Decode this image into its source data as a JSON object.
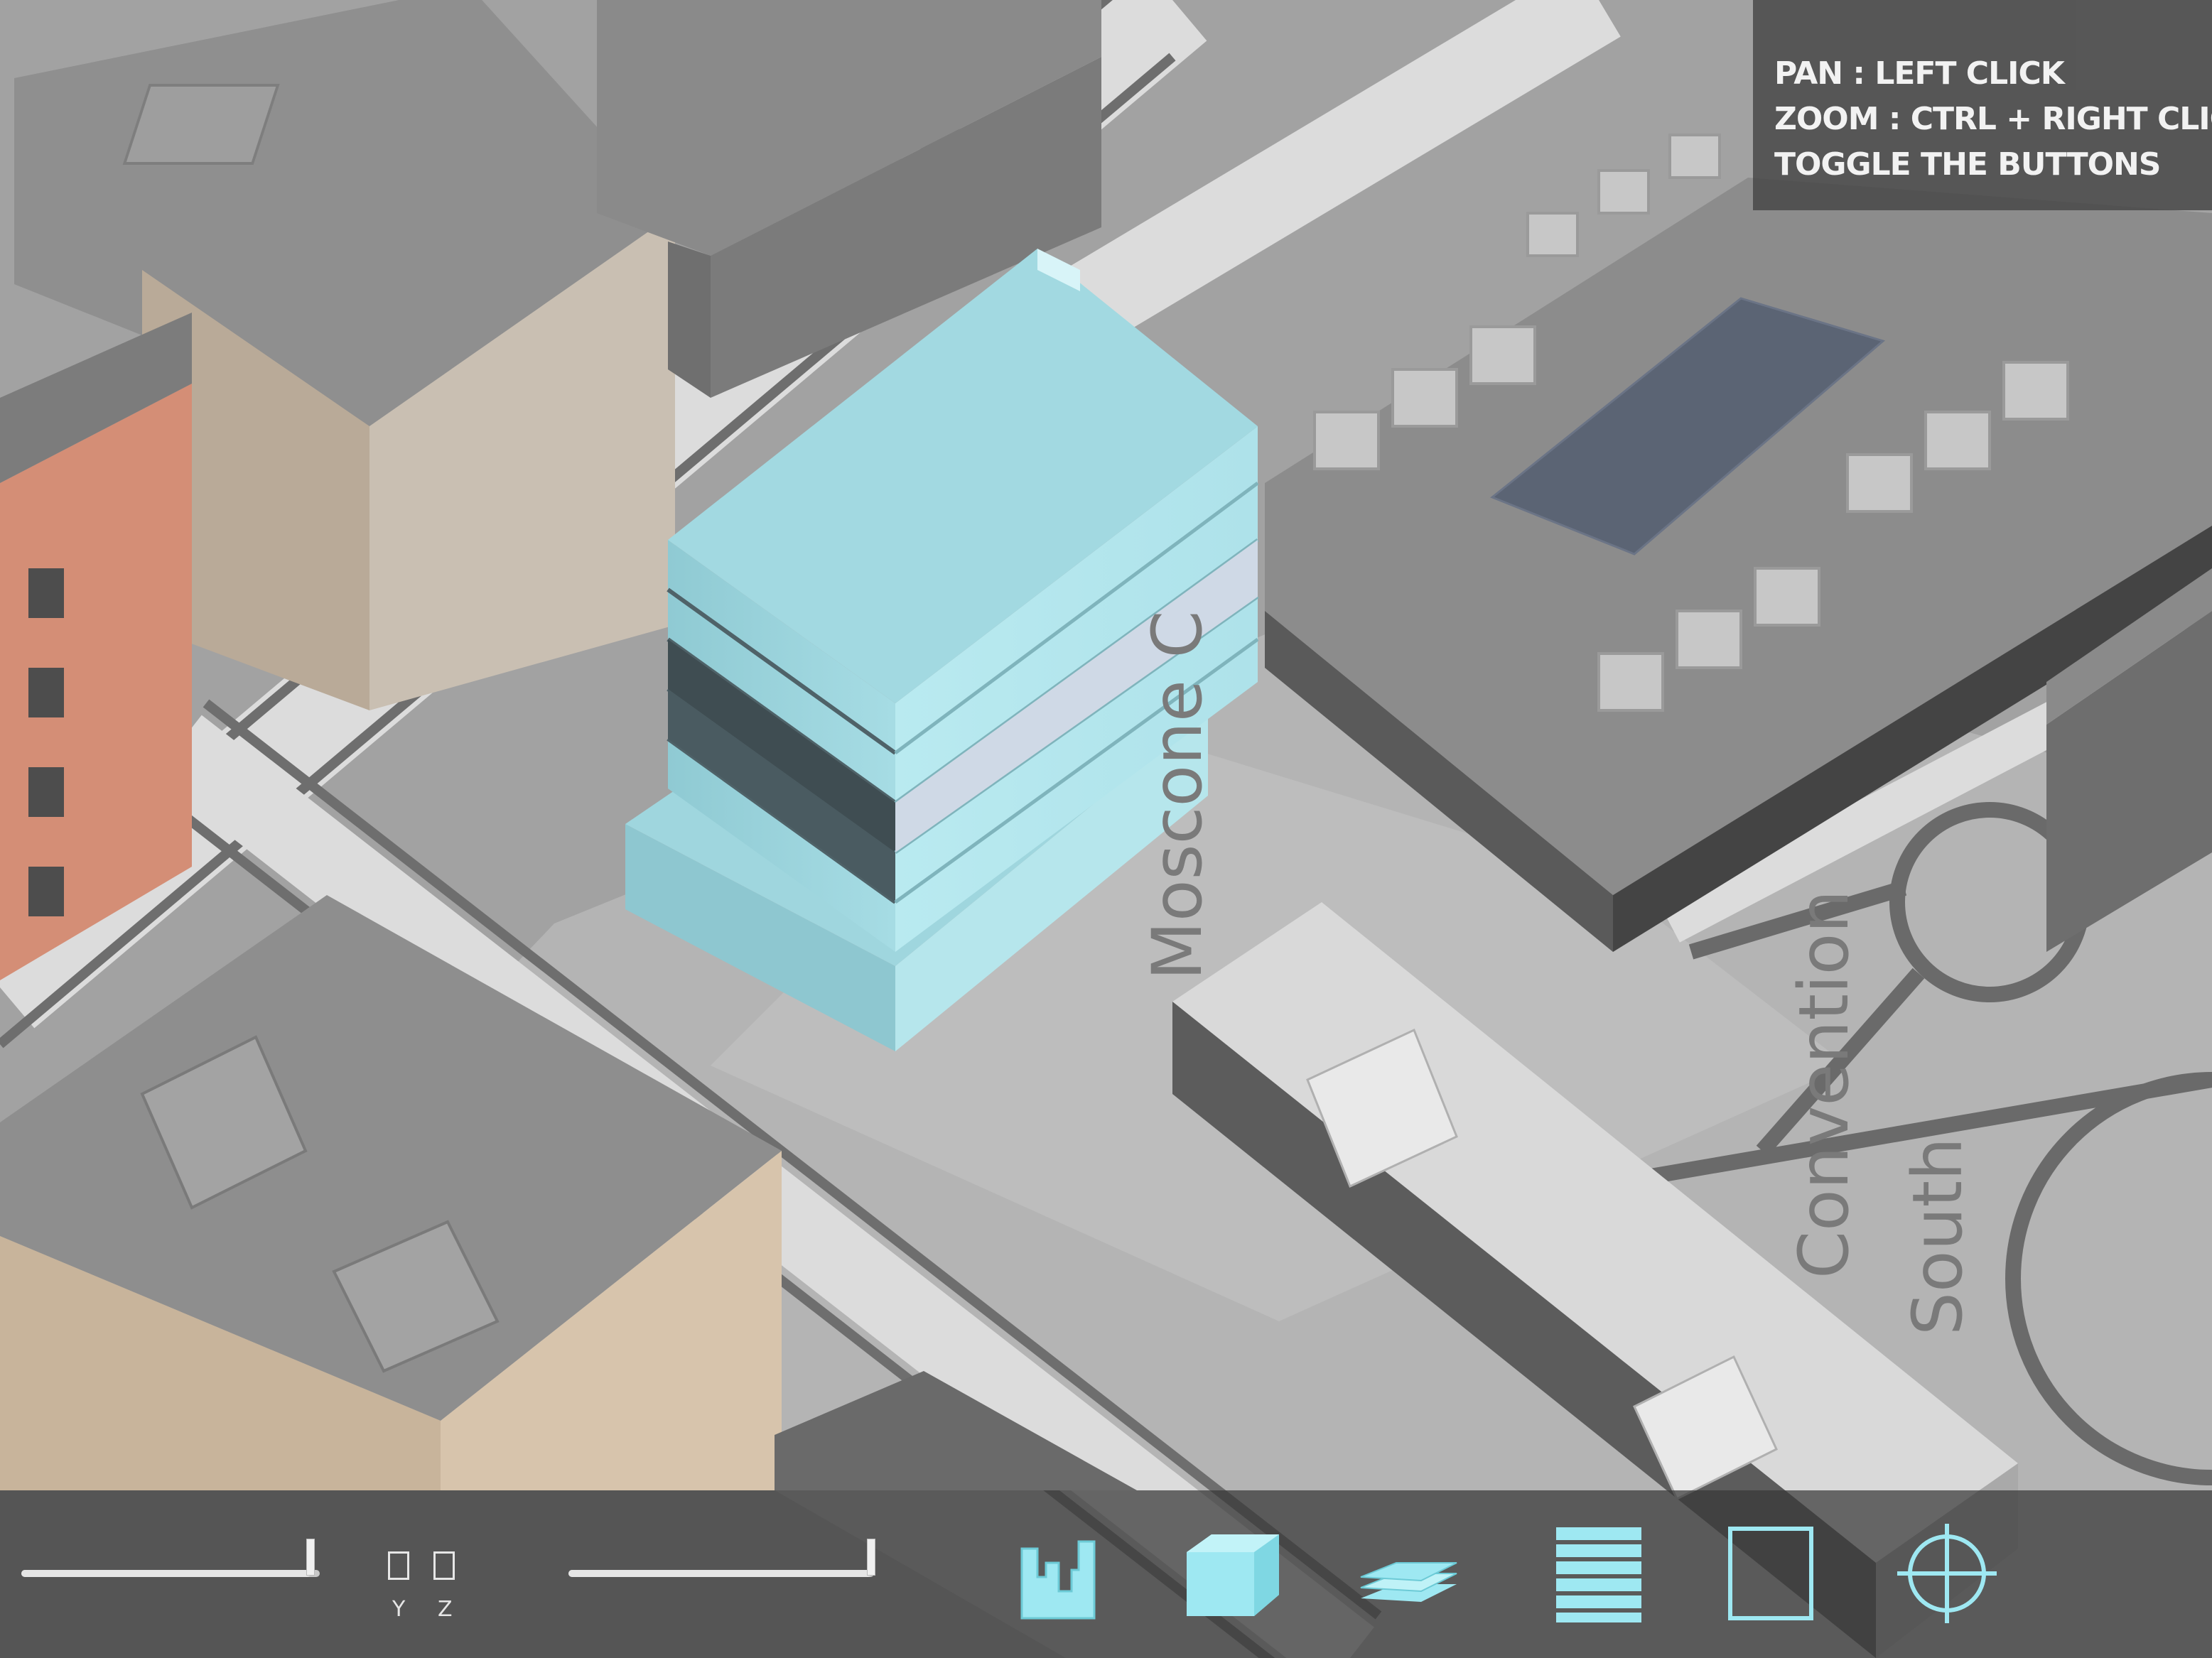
{
  "help": {
    "lines": [
      "PAN :  LEFT CLICK",
      "ZOOM : CTRL + RIGHT CLICK",
      "TOGGLE THE BUTTONS"
    ]
  },
  "toolbar": {
    "slider_1": {
      "value": 0.97
    },
    "slider_2": {
      "value": 0.99
    },
    "axis_toggle": {
      "labels": [
        "Y",
        "Z"
      ]
    },
    "buttons": [
      {
        "icon": "bar-chart-icon"
      },
      {
        "icon": "cube-icon"
      },
      {
        "icon": "layers-icon"
      },
      {
        "icon": "floors-icon"
      },
      {
        "icon": "outline-square-icon"
      },
      {
        "icon": "crosshair-icon"
      }
    ]
  },
  "map_labels": [
    "Moscone C",
    "Convention",
    "South"
  ],
  "colors": {
    "accent": "#9ee8f2",
    "building_highlight": "#a8dfe6",
    "toolbar_bg": "#373737",
    "panel_bg": "#464646"
  }
}
